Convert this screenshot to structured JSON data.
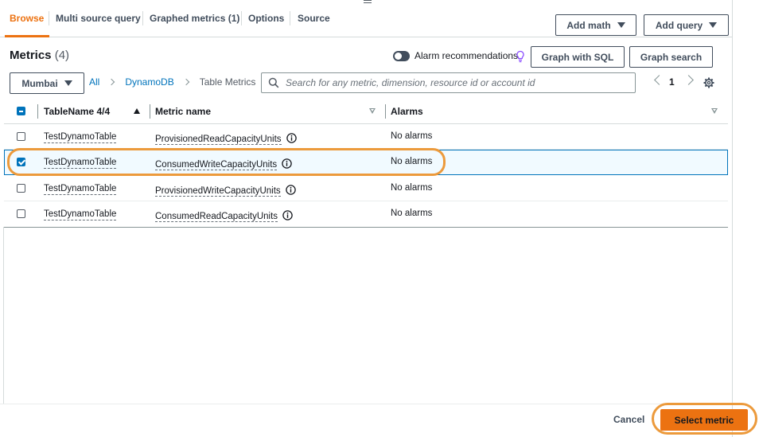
{
  "tabs": [
    {
      "label": "Browse",
      "active": true
    },
    {
      "label": "Multi source query",
      "active": false
    },
    {
      "label": "Graphed metrics (1)",
      "active": false
    },
    {
      "label": "Options",
      "active": false
    },
    {
      "label": "Source",
      "active": false
    }
  ],
  "toolbar": {
    "add_math": "Add math",
    "add_query": "Add query"
  },
  "metrics": {
    "title": "Metrics",
    "count": "(4)"
  },
  "alarm_recommendations": {
    "label": "Alarm recommendations",
    "enabled": false
  },
  "buttons": {
    "graph_sql": "Graph with SQL",
    "graph_search": "Graph search"
  },
  "region": {
    "value": "Mumbai"
  },
  "breadcrumb": {
    "all": "All",
    "namespace": "DynamoDB",
    "current": "Table Metrics"
  },
  "search": {
    "placeholder": "Search for any metric, dimension, resource id or account id",
    "value": ""
  },
  "pagination": {
    "page": "1"
  },
  "table": {
    "headers": {
      "col1": "TableName 4/4",
      "col2": "Metric name",
      "col3": "Alarms"
    },
    "rows": [
      {
        "table_name": "TestDynamoTable",
        "metric": "ProvisionedReadCapacityUnits",
        "alarms": "No alarms",
        "checked": false
      },
      {
        "table_name": "TestDynamoTable",
        "metric": "ConsumedWriteCapacityUnits",
        "alarms": "No alarms",
        "checked": true
      },
      {
        "table_name": "TestDynamoTable",
        "metric": "ProvisionedWriteCapacityUnits",
        "alarms": "No alarms",
        "checked": false
      },
      {
        "table_name": "TestDynamoTable",
        "metric": "ConsumedReadCapacityUnits",
        "alarms": "No alarms",
        "checked": false
      }
    ]
  },
  "footer": {
    "cancel": "Cancel",
    "select_metric": "Select metric"
  },
  "colors": {
    "accent": "#ec7211",
    "link": "#0073bb",
    "highlight": "#ec9a3c"
  },
  "icons": [
    "drag-handle-icon",
    "caret-down-icon",
    "bulb-icon",
    "chevron-right-icon",
    "search-icon",
    "chevron-left-icon",
    "gear-icon",
    "info-icon",
    "sort-icon"
  ]
}
